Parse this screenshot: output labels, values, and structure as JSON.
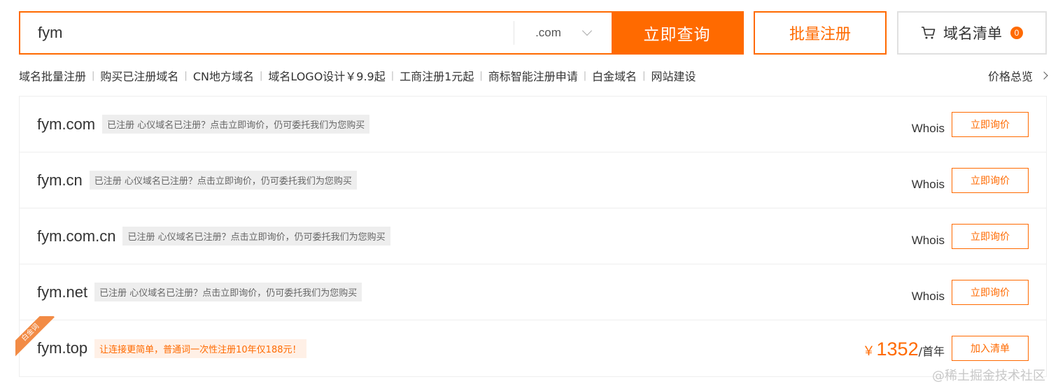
{
  "search": {
    "query": "fym",
    "suffix": ".com",
    "button_label": "立即查询"
  },
  "batch_button": "批量注册",
  "cart": {
    "label": "域名清单",
    "count": "0"
  },
  "quick_links": [
    "域名批量注册",
    "购买已注册域名",
    "CN地方域名",
    "域名LOGO设计￥9.9起",
    "工商注册1元起",
    "商标智能注册申请",
    "白金域名",
    "网站建设"
  ],
  "price_overview": "价格总览",
  "results": [
    {
      "domain": "fym.com",
      "tag": "已注册 心仪域名已注册？点击立即询价，仍可委托我们为您购买",
      "whois": "Whois",
      "action": "立即询价"
    },
    {
      "domain": "fym.cn",
      "tag": "已注册 心仪域名已注册？点击立即询价，仍可委托我们为您购买",
      "whois": "Whois",
      "action": "立即询价"
    },
    {
      "domain": "fym.com.cn",
      "tag": "已注册 心仪域名已注册？点击立即询价，仍可委托我们为您购买",
      "whois": "Whois",
      "action": "立即询价"
    },
    {
      "domain": "fym.net",
      "tag": "已注册 心仪域名已注册？点击立即询价，仍可委托我们为您购买",
      "whois": "Whois",
      "action": "立即询价"
    },
    {
      "domain": "fym.top",
      "tag": "让连接更简单，普通词一次性注册10年仅188元！",
      "ribbon": "白金词",
      "price_currency": "￥",
      "price_amount": "1352",
      "price_unit": "/首年",
      "action": "加入清单"
    }
  ],
  "watermark": "@稀土掘金技术社区",
  "colors": {
    "accent": "#ff6a00",
    "tag_bg": "#eeeeee",
    "promo_bg": "#fff0e6"
  }
}
